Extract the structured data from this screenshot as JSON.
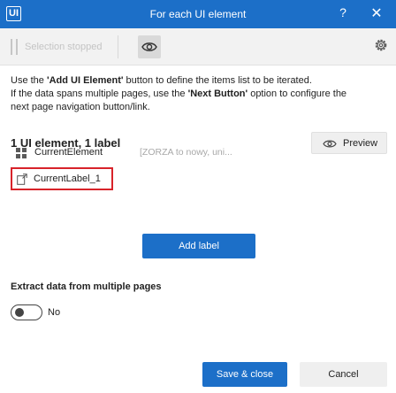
{
  "window": {
    "app_icon_text": "UI",
    "title": "For each UI element",
    "help_label": "?",
    "close_label": "✕"
  },
  "toolbar": {
    "selection_status": "Selection stopped",
    "icons": [
      "pause-icon",
      "eye-icon",
      "gear-icon"
    ]
  },
  "instructions": {
    "line1_pre": "Use the ",
    "line1_bold": "'Add UI Element'",
    "line1_post": " button to define the items list to be iterated.",
    "line2_pre": "If the data spans multiple pages, use the ",
    "line2_bold": "'Next Button'",
    "line2_post": " option to configure the",
    "line3": "next page navigation button/link."
  },
  "summary": "1 UI element, 1 label",
  "preview_label": "Preview",
  "element": {
    "name": "CurrentElement",
    "value": "[ZORZA to nowy, uni..."
  },
  "label_item": {
    "name": "CurrentLabel_1"
  },
  "add_label_button": "Add label",
  "extract": {
    "title": "Extract data from multiple pages",
    "toggle_state": "No",
    "enabled": false
  },
  "footer": {
    "save_label": "Save & close",
    "cancel_label": "Cancel"
  },
  "colors": {
    "accent": "#1c6fc8",
    "highlight_border": "#d8232a"
  }
}
